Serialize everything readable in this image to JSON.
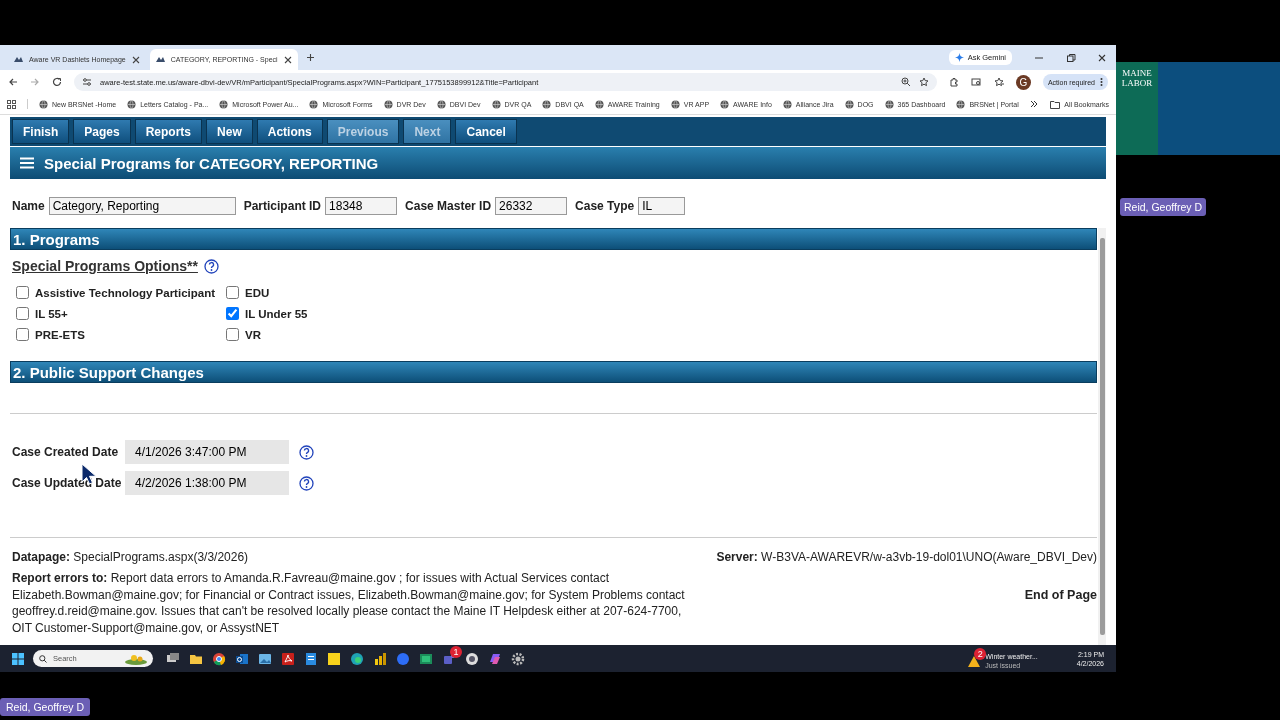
{
  "browser": {
    "tabs": [
      {
        "label": "Aware VR Dashlets Homepage",
        "selected": false
      },
      {
        "label": "CATEGORY, REPORTING - Speci",
        "selected": true
      }
    ],
    "ask_button": "Ask Gemini",
    "url": "aware-test.state.me.us/aware-dbvi-dev/VR/mParticipant/SpecialPrograms.aspx?WIN=Participant_1775153899912&Title=Participant",
    "profile_initial": "G",
    "action_button": "Action required",
    "bookmarks": [
      "New BRSNet -Home",
      "Letters Catalog - Pa...",
      "Microsoft Power Au...",
      "Microsoft Forms",
      "DVR Dev",
      "DBVI Dev",
      "DVR QA",
      "DBVI QA",
      "AWARE Training",
      "VR APP",
      "AWARE Info",
      "Alliance Jira",
      "DOG",
      "365 Dashboard",
      "BRSNet | Portal"
    ],
    "all_bookmarks": "All Bookmarks"
  },
  "toolbar": {
    "buttons": [
      {
        "label": "Finish",
        "disabled": false
      },
      {
        "label": "Pages",
        "disabled": false
      },
      {
        "label": "Reports",
        "disabled": false
      },
      {
        "label": "New",
        "disabled": false
      },
      {
        "label": "Actions",
        "disabled": false
      },
      {
        "label": "Previous",
        "disabled": true
      },
      {
        "label": "Next",
        "disabled": true
      },
      {
        "label": "Cancel",
        "disabled": false
      }
    ]
  },
  "page_title": "Special Programs for CATEGORY, REPORTING",
  "fields": [
    {
      "label": "Name",
      "value": "Category, Reporting"
    },
    {
      "label": "Participant ID",
      "value": "18348"
    },
    {
      "label": "Case Master ID",
      "value": "26332"
    },
    {
      "label": "Case Type",
      "value": "IL"
    }
  ],
  "programs": {
    "section_title": "1. Programs",
    "options_title": "Special Programs Options**",
    "options": [
      {
        "label": "Assistive Technology Participant",
        "checked": false
      },
      {
        "label": "EDU",
        "checked": false
      },
      {
        "label": "IL 55+",
        "checked": false
      },
      {
        "label": "IL Under 55",
        "checked": true
      },
      {
        "label": "PRE-ETS",
        "checked": false
      },
      {
        "label": "VR",
        "checked": false
      }
    ]
  },
  "public_support": {
    "section_title": "2. Public Support Changes",
    "dates": [
      {
        "label": "Case Created Date",
        "value": "4/1/2026 3:47:00 PM"
      },
      {
        "label": "Case Updated Date",
        "value": "4/2/2026 1:38:00 PM"
      }
    ]
  },
  "footer": {
    "datapage": "**Datapage:** SpecialPrograms.aspx(3/3/2026)",
    "server": "**Server:** W-B3VA-AWAREVR/w-a3vb-19-dol01\\UNO(Aware_DBVI_Dev)",
    "report": "**Report errors to:** Report data errors to Amanda.R.Favreau@maine.gov ; for issues with Actual Services contact Elizabeth.Bowman@maine.gov; for Financial or Contract issues, Elizabeth.Bowman@maine.gov; for System Problems contact geoffrey.d.reid@maine.gov. Issues that can't be resolved locally please contact the Maine IT Helpdesk either at 207-624-7700, OIT Customer-Support@maine.gov, or AssystNET",
    "end_of_page": "End of Page"
  },
  "taskbar": {
    "search_placeholder": "Search",
    "weather_badge": "2",
    "weather_title": "Winter weather...",
    "weather_sub": "Just issued",
    "teams_badge": "1",
    "time": "2:19 PM",
    "date": "4/2/2026"
  },
  "call": {
    "logo_top": "MAINE",
    "logo_bottom": "LABOR",
    "tile_name": "Reid, Geoffrey D",
    "self_name": "Reid, Geoffrey D"
  }
}
